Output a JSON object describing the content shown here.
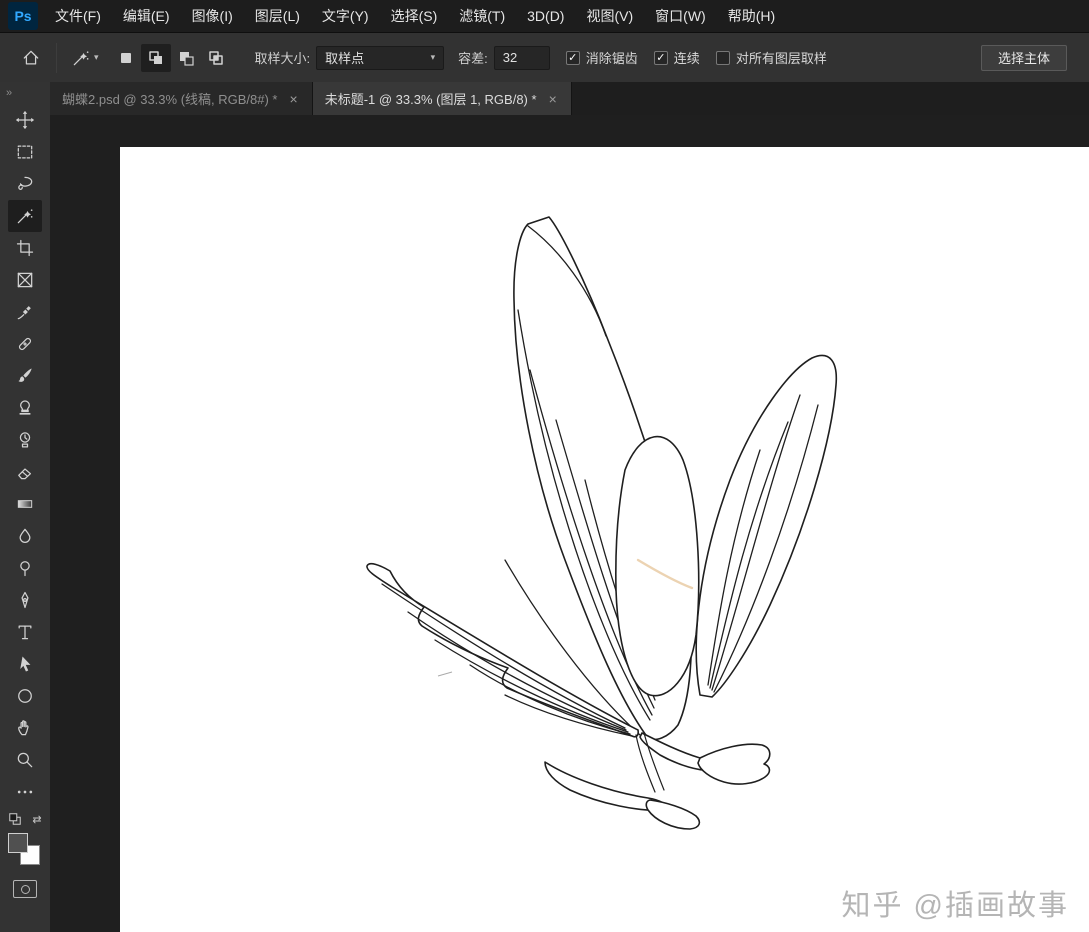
{
  "app": {
    "name": "Adobe Photoshop",
    "logo_text": "Ps"
  },
  "menu_bar": {
    "items": [
      {
        "label": "文件(F)"
      },
      {
        "label": "编辑(E)"
      },
      {
        "label": "图像(I)"
      },
      {
        "label": "图层(L)"
      },
      {
        "label": "文字(Y)"
      },
      {
        "label": "选择(S)"
      },
      {
        "label": "滤镜(T)"
      },
      {
        "label": "3D(D)"
      },
      {
        "label": "视图(V)"
      },
      {
        "label": "窗口(W)"
      },
      {
        "label": "帮助(H)"
      }
    ]
  },
  "options_bar": {
    "active_tool": "magic-wand",
    "dropdown_caret": "▾",
    "selection_modes": [
      "new-selection",
      "add-to-selection",
      "subtract-from-selection",
      "intersect-selection"
    ],
    "active_selection_mode": "add-to-selection",
    "sample_size": {
      "label": "取样大小:",
      "value": "取样点"
    },
    "tolerance": {
      "label": "容差:",
      "value": "32"
    },
    "anti_alias": {
      "label": "消除锯齿",
      "checked": true
    },
    "contiguous": {
      "label": "连续",
      "checked": true
    },
    "sample_all_layers": {
      "label": "对所有图层取样",
      "checked": false
    },
    "select_subject": {
      "label": "选择主体"
    }
  },
  "document_tabs": [
    {
      "title": "蝴蝶2.psd @ 33.3% (线稿, RGB/8#) *",
      "close": "×",
      "active": false
    },
    {
      "title": "未标题-1 @ 33.3% (图层 1, RGB/8) *",
      "close": "×",
      "active": true
    }
  ],
  "toolbar": {
    "collapse_glyph": "»",
    "swap_glyph": "⇄",
    "tools": [
      {
        "name": "move-tool"
      },
      {
        "name": "rectangular-marquee-tool"
      },
      {
        "name": "lasso-tool"
      },
      {
        "name": "magic-wand-tool",
        "active": true
      },
      {
        "name": "crop-tool"
      },
      {
        "name": "frame-tool"
      },
      {
        "name": "eyedropper-tool"
      },
      {
        "name": "spot-healing-brush-tool"
      },
      {
        "name": "brush-tool"
      },
      {
        "name": "clone-stamp-tool"
      },
      {
        "name": "history-brush-tool"
      },
      {
        "name": "eraser-tool"
      },
      {
        "name": "gradient-tool"
      },
      {
        "name": "blur-tool"
      },
      {
        "name": "dodge-tool"
      },
      {
        "name": "pen-tool"
      },
      {
        "name": "type-tool",
        "glyph": "T"
      },
      {
        "name": "path-selection-tool"
      },
      {
        "name": "ellipse-tool"
      },
      {
        "name": "hand-tool"
      },
      {
        "name": "zoom-tool"
      },
      {
        "name": "edit-toolbar"
      }
    ],
    "foreground_color": "#505050",
    "background_color": "#ffffff"
  },
  "canvas": {
    "zoom": "33.3%",
    "artwork": "butterfly line-art sketch",
    "background": "#ffffff"
  },
  "watermark": {
    "text": "知乎 @插画故事"
  },
  "colors": {
    "menubar_bg": "#1d1d1d",
    "optionsbar_bg": "#323232",
    "panel_bg": "#333333",
    "pasteboard_bg": "#1f1f1f",
    "active_tab_bg": "#383838",
    "ps_logo_bg": "#00253f",
    "ps_logo_text": "#31a8ff"
  }
}
